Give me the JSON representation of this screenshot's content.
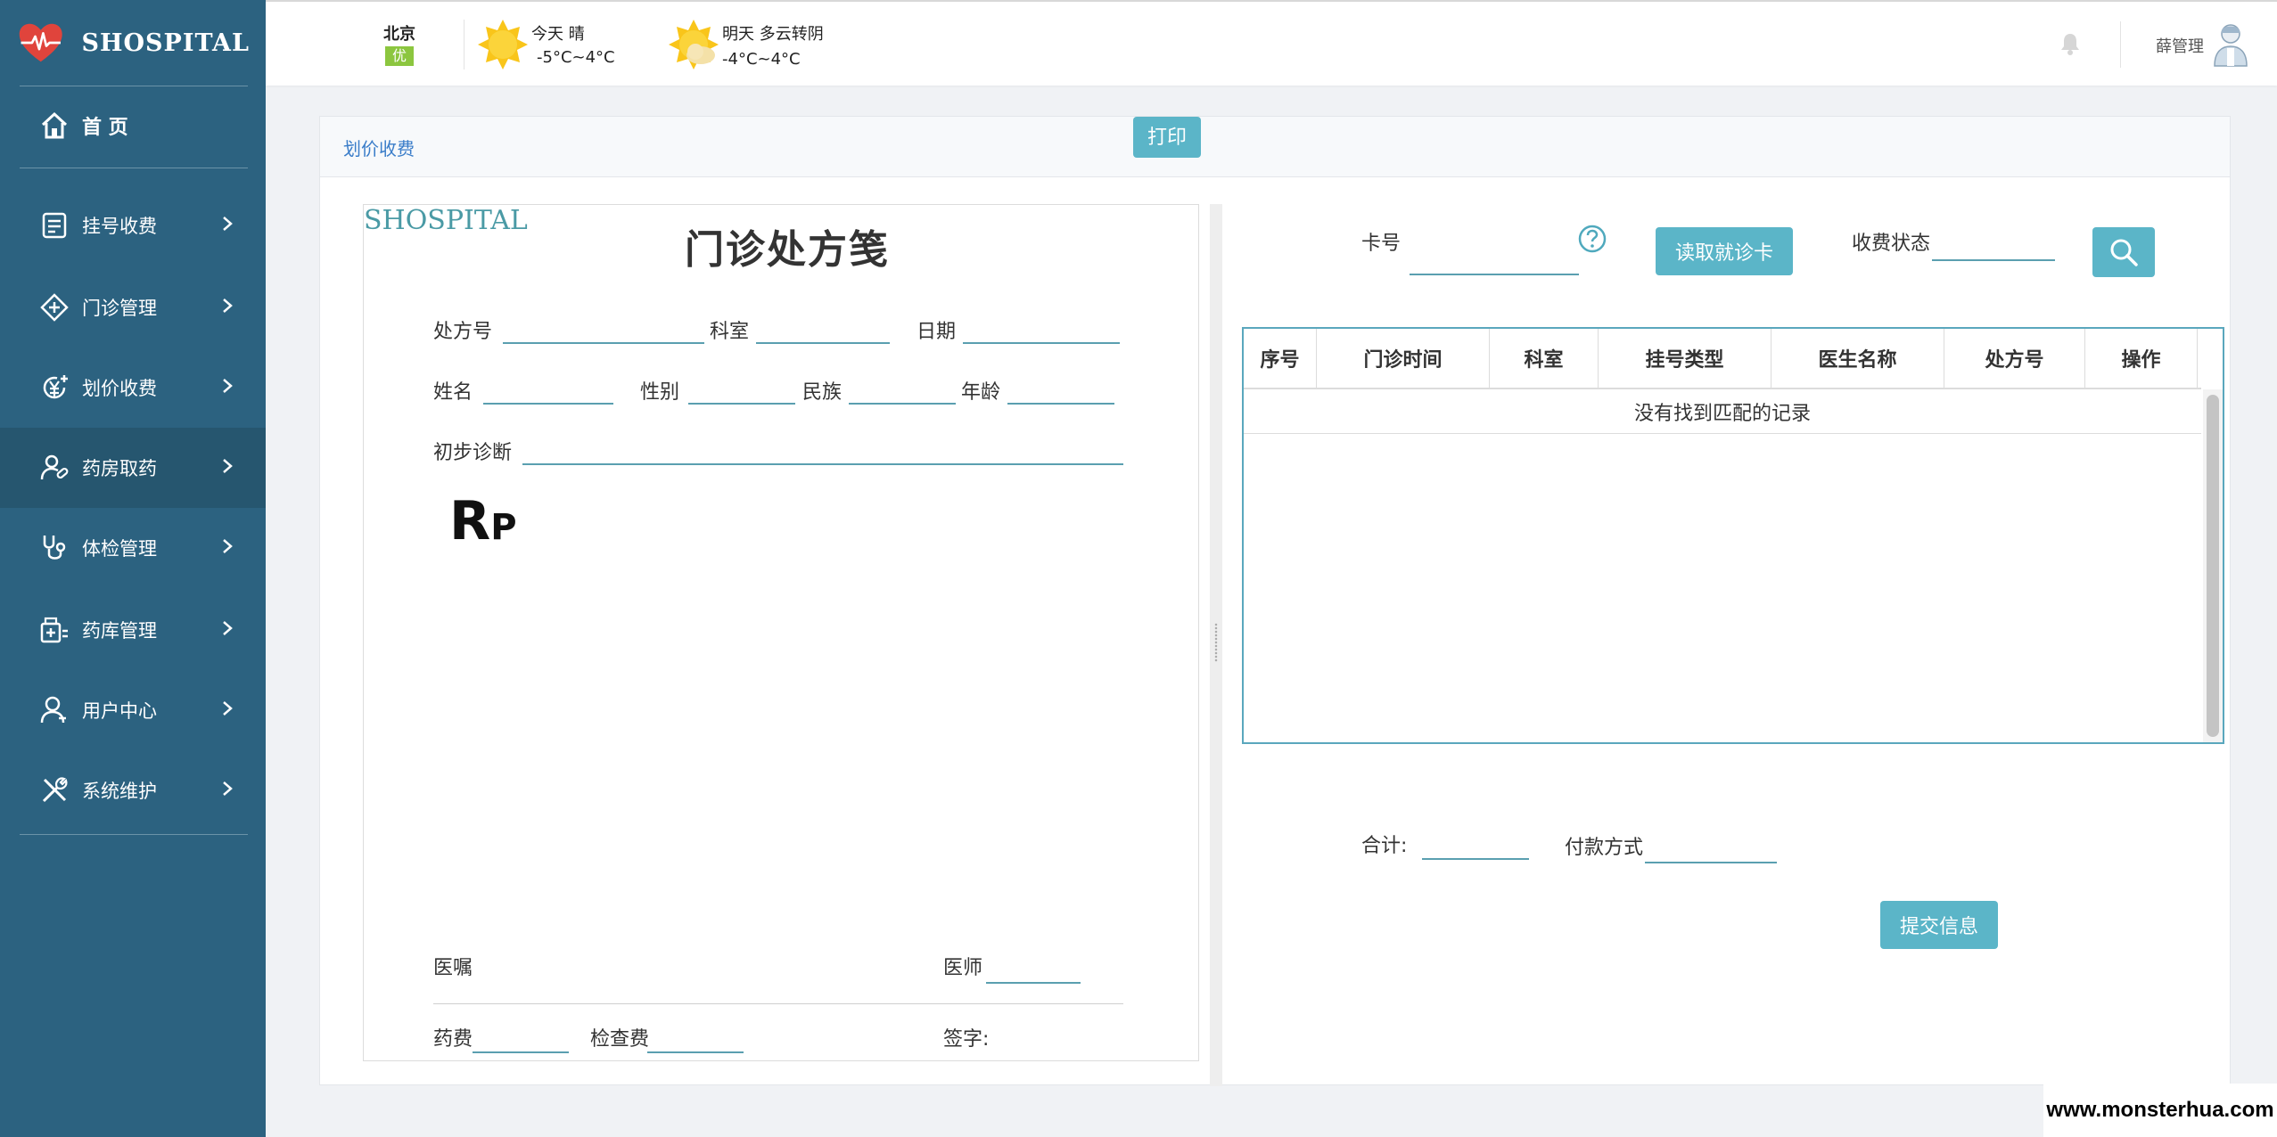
{
  "app": {
    "brand": "SHOSPITAL"
  },
  "sidebar": {
    "home": "首 页",
    "items": [
      {
        "label": "挂号收费",
        "icon": "register-fee-icon"
      },
      {
        "label": "门诊管理",
        "icon": "outpatient-icon"
      },
      {
        "label": "划价收费",
        "icon": "pricing-fee-icon"
      },
      {
        "label": "药房取药",
        "icon": "pharmacy-icon",
        "active": true
      },
      {
        "label": "体检管理",
        "icon": "stethoscope-icon"
      },
      {
        "label": "药库管理",
        "icon": "medicine-storage-icon"
      },
      {
        "label": "用户中心",
        "icon": "user-icon"
      },
      {
        "label": "系统维护",
        "icon": "tools-icon"
      }
    ]
  },
  "header": {
    "city": "北京",
    "aqi": "优",
    "today": {
      "label": "今天  晴",
      "temp": "-5°C~4°C"
    },
    "tomorrow": {
      "label": "明天  多云转阴",
      "temp": "-4°C~4°C"
    },
    "username": "薛管理"
  },
  "card": {
    "title": "划价收费",
    "print_label": "打印"
  },
  "rx": {
    "brand": "SHOSPITAL",
    "title": "门诊处方笺",
    "labels": {
      "rx_no": "处方号",
      "dept": "科室",
      "date": "日期",
      "name": "姓名",
      "gender": "性别",
      "ethnicity": "民族",
      "age": "年龄",
      "diagnosis": "初步诊断",
      "advice": "医嘱",
      "doctor": "医师",
      "drug_fee": "药费",
      "exam_fee": "检查费",
      "signature": "签字:"
    },
    "symbol_r": "R",
    "symbol_p": "P"
  },
  "search": {
    "card_no_label": "卡号",
    "read_card_button": "读取就诊卡",
    "status_label": "收费状态"
  },
  "table": {
    "columns": [
      "序号",
      "门诊时间",
      "科室",
      "挂号类型",
      "医生名称",
      "处方号",
      "操作"
    ],
    "empty_text": "没有找到匹配的记录"
  },
  "footer": {
    "total_label": "合计:",
    "payment_label": "付款方式",
    "submit_button": "提交信息"
  },
  "watermark": "www.monsterhua.com"
}
